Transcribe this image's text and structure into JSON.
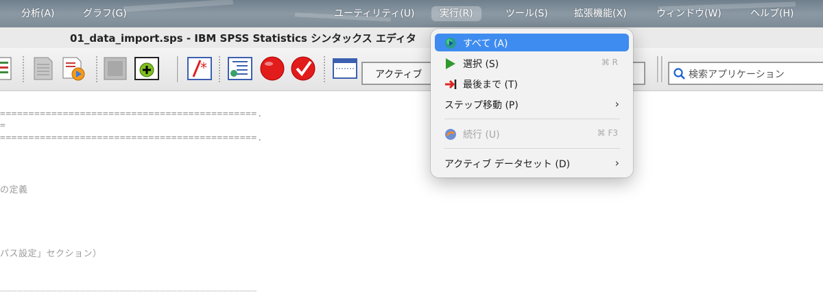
{
  "menubar": {
    "items": [
      {
        "label": "分析(A)"
      },
      {
        "label": "グラフ(G)"
      },
      {
        "label": "ユーティリティ(U)"
      },
      {
        "label": "実行(R)"
      },
      {
        "label": "ツール(S)"
      },
      {
        "label": "拡張機能(X)"
      },
      {
        "label": "ウィンドウ(W)"
      },
      {
        "label": "ヘルプ(H)"
      }
    ]
  },
  "window": {
    "title": "01_data_import.sps - IBM SPSS Statistics シンタックス エディタ"
  },
  "toolbar": {
    "active_dataset_label": "アクティブ",
    "search_placeholder": "検索アプリケーション"
  },
  "editor": {
    "lines": [
      "=============================================.",
      "=",
      "=============================================.",
      "の定義",
      "パス設定」セクション）",
      "_____________________________________________"
    ]
  },
  "run_menu": {
    "items": [
      {
        "label": "すべて (A)",
        "shortcut": "",
        "icon": "run-all-icon",
        "selected": true
      },
      {
        "label": "選択 (S)",
        "shortcut": "⌘ R",
        "icon": "play-icon"
      },
      {
        "label": "最後まで (T)",
        "shortcut": "",
        "icon": "run-to-end-icon"
      },
      {
        "label": "ステップ移動 (P)",
        "shortcut": "",
        "icon": "",
        "submenu": true
      },
      {
        "label": "続行 (U)",
        "shortcut": "⌘ F3",
        "icon": "continue-icon",
        "disabled": true
      },
      {
        "label": "アクティブ データセット (D)",
        "shortcut": "",
        "icon": "",
        "submenu": true
      }
    ],
    "chevron": "›"
  },
  "colors": {
    "selection": "#3f8cf0",
    "menu_bg": "#f3f2f2"
  }
}
